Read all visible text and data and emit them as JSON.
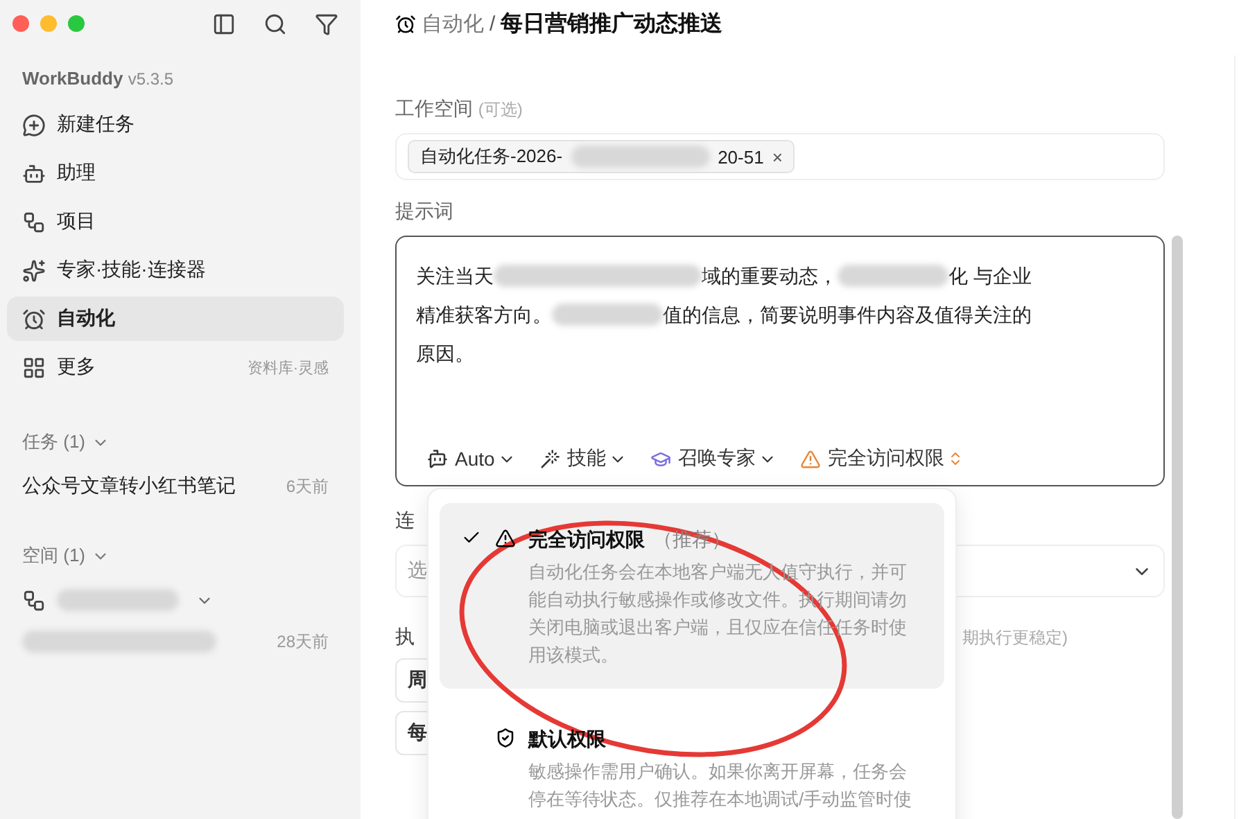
{
  "sidebar": {
    "app_name": "WorkBuddy",
    "version": "v5.3.5",
    "nav": [
      {
        "label": "新建任务",
        "selected": false
      },
      {
        "label": "助理",
        "selected": false
      },
      {
        "label": "项目",
        "selected": false
      },
      {
        "label": "专家·技能·连接器",
        "selected": false
      },
      {
        "label": "自动化",
        "selected": true
      },
      {
        "label": "更多",
        "hint": "资料库·灵感",
        "selected": false
      }
    ],
    "tasks": {
      "title": "任务 (1)",
      "items": [
        {
          "name": "公众号文章转小红书笔记",
          "time": "6天前"
        }
      ]
    },
    "spaces": {
      "title": "空间 (1)",
      "items": [
        {
          "time": "28天前"
        }
      ]
    }
  },
  "breadcrumb": {
    "parent": "自动化",
    "separator": "/",
    "current": "每日营销推广动态推送"
  },
  "workspace": {
    "label": "工作空间",
    "optional": "(可选)",
    "chip_start": "自动化任务-2026-",
    "chip_end": "20-51",
    "remove": "×"
  },
  "prompt": {
    "label": "提示词",
    "lines": [
      [
        {
          "kind": "text",
          "text": "关注当天"
        },
        {
          "kind": "redacted"
        },
        {
          "kind": "text",
          "text": "域的重要动态，"
        },
        {
          "kind": "redacted"
        },
        {
          "kind": "text",
          "text": "化 与企业"
        }
      ],
      [
        {
          "kind": "text",
          "text": "精准获客方向。"
        },
        {
          "kind": "redacted"
        },
        {
          "kind": "text",
          "text": "值的信息，简要说明事件内容及值得关注的"
        }
      ],
      [
        {
          "kind": "text",
          "text": "原因。"
        }
      ]
    ],
    "toolbar": [
      {
        "kind": "model",
        "label": "Auto"
      },
      {
        "kind": "skills",
        "label": "技能"
      },
      {
        "kind": "expert",
        "label": "召唤专家"
      },
      {
        "kind": "permission",
        "label": "完全访问权限"
      }
    ]
  },
  "connector": {
    "label": "连",
    "placeholder": "选"
  },
  "execution": {
    "label": "执",
    "hint": "期执行更稳定)",
    "field_1": "周",
    "field_2": "每"
  },
  "permission_menu": [
    {
      "kind": "full",
      "title": "完全访问权限",
      "tag": "（推荐）",
      "selected": true,
      "description": "自动化任务会在本地客户端无人值守执行，并可能自动执行敏感操作或修改文件。执行期间请勿关闭电脑或退出客户端，且仅应在信任任务时使用该模式。"
    },
    {
      "kind": "default",
      "title": "默认权限",
      "selected": false,
      "description": "敏感操作需用户确认。如果你离开屏幕，任务会停在等待状态。仅推荐在本地调试/手动监管时使"
    }
  ]
}
